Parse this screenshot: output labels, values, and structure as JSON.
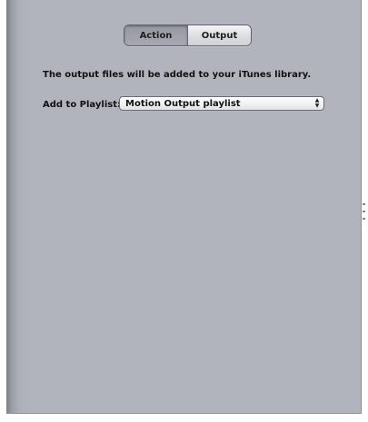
{
  "tabs": {
    "action_label": "Action",
    "output_label": "Output",
    "selected": "Action"
  },
  "info_text": "The output files will be added to your iTunes library.",
  "playlist": {
    "label": "Add to Playlist:",
    "selected_value": "Motion Output playlist",
    "arrows_icon": "up-down-arrows-icon"
  },
  "colors": {
    "panel_background": "#b1b4bd",
    "active_segment": "#9ea1aa",
    "inactive_segment": "#e2e3e7"
  }
}
